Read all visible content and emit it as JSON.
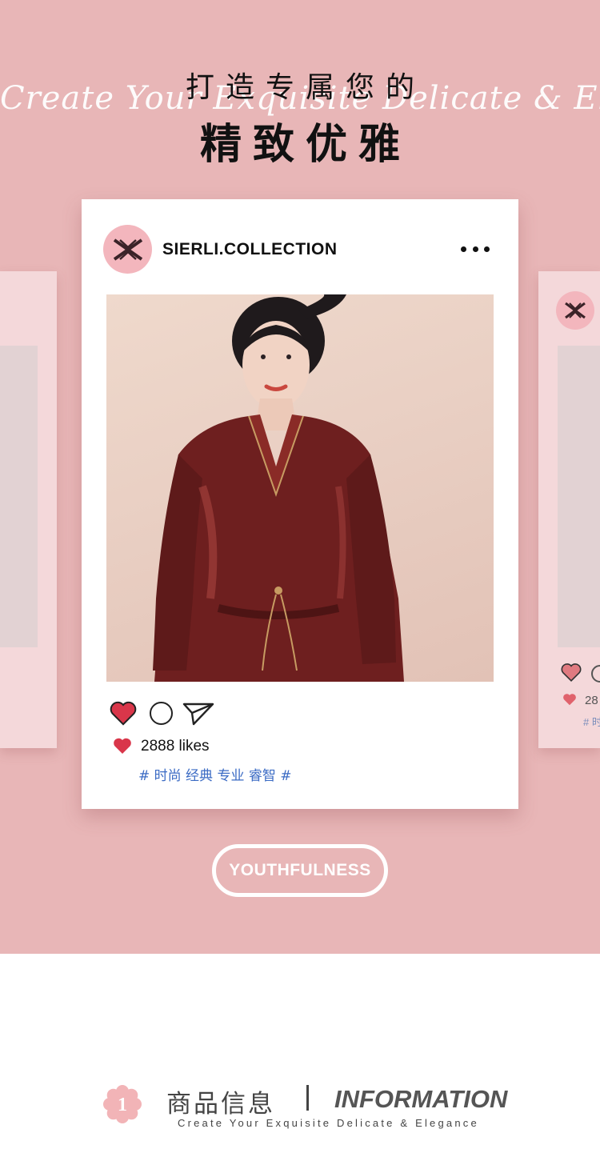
{
  "header": {
    "script_text": "Create Your Exquisite Delicate & Elegance",
    "title_line1": "打造专属您的",
    "title_line2": "精致优雅"
  },
  "post": {
    "username": "SIERLI.COLLECTION",
    "likes_text": "2888 likes",
    "tags": "# 时尚 经典 专业 睿智 #"
  },
  "side_cards": {
    "right_likes_text": "28",
    "right_tags_text": "# 时"
  },
  "youth_button": {
    "label": "YOUTHFULNESS"
  },
  "info": {
    "badge_number": "1",
    "title_cn": "商品信息",
    "title_en": "INFORMATION",
    "subtitle": "Create Your Exquisite Delicate & Elegance"
  },
  "icons": {
    "avatar": "sierli-logo-icon",
    "more": "more-dots-icon",
    "like": "heart-icon",
    "comment": "comment-circle-icon",
    "share": "paper-plane-icon",
    "badge": "flower-number-icon"
  },
  "colors": {
    "background_pink": "#e8b6b7",
    "card_white": "#ffffff",
    "side_card": "#f4d8da",
    "heart_red": "#d9364a",
    "tag_blue": "#3b6bc4",
    "avatar_pink": "#f3b6bd"
  }
}
